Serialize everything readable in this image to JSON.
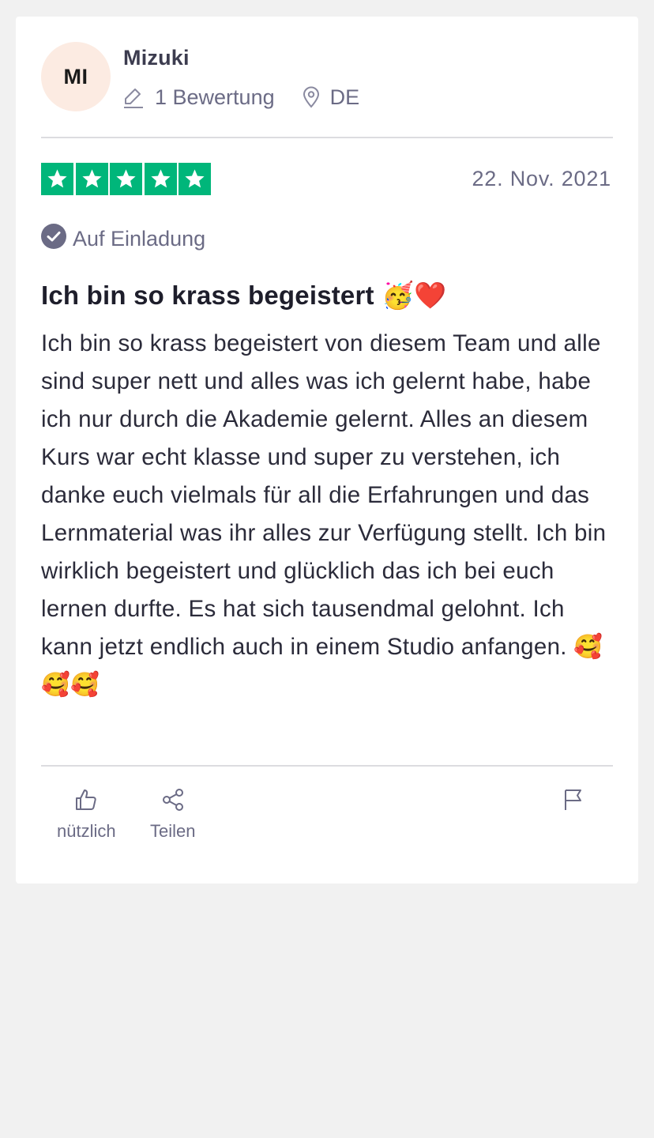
{
  "reviewer": {
    "initials": "MI",
    "name": "Mizuki",
    "review_count": "1 Bewertung",
    "country": "DE"
  },
  "review": {
    "rating": 5,
    "date": "22. Nov. 2021",
    "invitation_label": "Auf Einladung",
    "title": "Ich bin so krass begeistert 🥳❤️",
    "text": "Ich bin so krass begeistert von diesem Team und alle sind super nett und alles was ich gelernt habe, habe ich nur durch die Akademie gelernt. Alles an diesem Kurs war echt klasse und super zu verstehen, ich danke euch vielmals für all die Erfahrungen und das Lernmaterial was ihr alles zur Verfügung stellt. Ich bin wirklich begeistert und glücklich das ich bei euch lernen durfte. Es hat sich tausendmal gelohnt. Ich kann jetzt endlich auch in einem Studio anfangen. 🥰🥰🥰"
  },
  "actions": {
    "useful_label": "nützlich",
    "share_label": "Teilen"
  },
  "colors": {
    "star_green": "#00b67a",
    "avatar_bg": "#fcebe2",
    "muted_text": "#6b6b85"
  },
  "icons": [
    "pencil-icon",
    "location-pin-icon",
    "star-icon",
    "verified-check-icon",
    "thumbs-up-icon",
    "share-icon",
    "flag-icon"
  ]
}
